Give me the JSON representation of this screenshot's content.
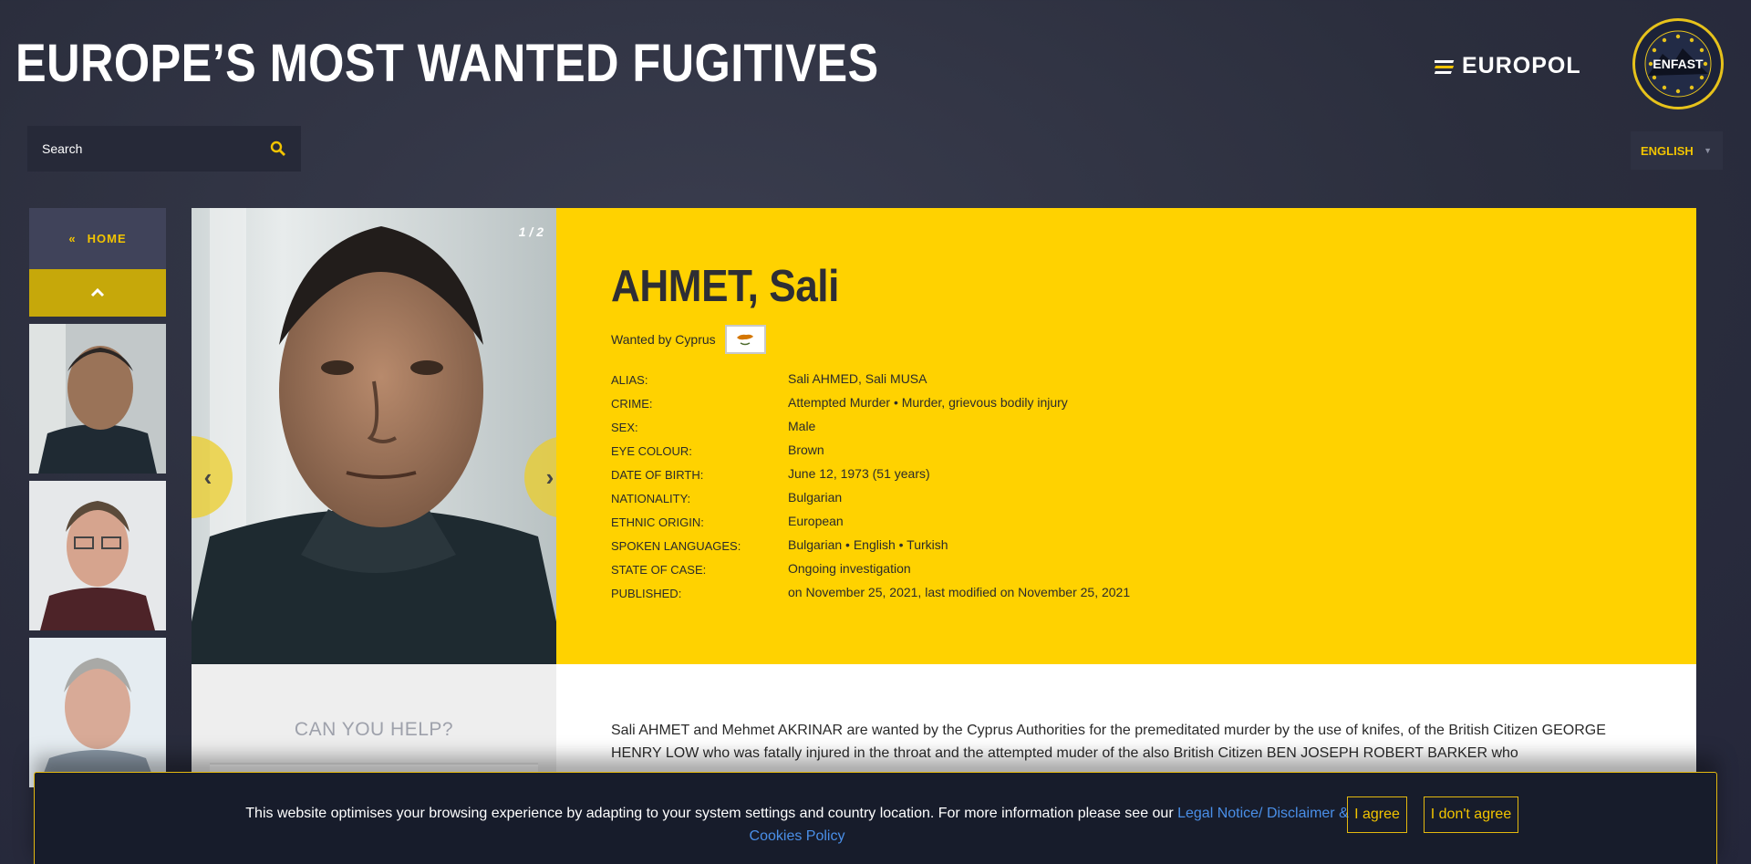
{
  "header": {
    "title": "EUROPE’S MOST WANTED FUGITIVES",
    "europol_logo": "EUROPOL",
    "enfast_logo": "ENFAST"
  },
  "search": {
    "placeholder": "Search"
  },
  "language": {
    "selected": "ENGLISH"
  },
  "sidebar": {
    "home_label": "HOME",
    "home_icon": "double-chevron-left-icon",
    "up_icon": "chevron-up-icon"
  },
  "profile": {
    "photo_counter": "1 / 2",
    "name": "AHMET, Sali",
    "wanted_by": "Wanted by Cyprus",
    "facts": [
      {
        "label": "ALIAS:",
        "value": "Sali AHMED, Sali MUSA"
      },
      {
        "label": "CRIME:",
        "value": "Attempted Murder • Murder, grievous bodily injury"
      },
      {
        "label": "SEX:",
        "value": "Male"
      },
      {
        "label": "EYE COLOUR:",
        "value": "Brown"
      },
      {
        "label": "DATE OF BIRTH:",
        "value": "June 12, 1973 (51 years)"
      },
      {
        "label": "NATIONALITY:",
        "value": "Bulgarian"
      },
      {
        "label": "ETHNIC ORIGIN:",
        "value": "European"
      },
      {
        "label": "SPOKEN LANGUAGES:",
        "value": "Bulgarian • English • Turkish"
      },
      {
        "label": "STATE OF CASE:",
        "value": "Ongoing investigation"
      },
      {
        "label": "PUBLISHED:",
        "value": "on November 25, 2021, last modified on November 25, 2021"
      }
    ],
    "description": "Sali AHMET and  Mehmet AKRINAR are wanted by the Cyprus Authorities for the premeditated murder by the use of knifes, of the British Citizen GEORGE HENRY LOW who was fatally injured in the throat and the attempted muder of the also British Citizen BEN JOSEPH ROBERT BARKER who"
  },
  "help": {
    "title": "CAN YOU HELP?"
  },
  "cookie": {
    "text": "This website optimises your browsing experience by adapting to your system settings and country location. For more information please see our ",
    "link_text": "Legal Notice/ Disclaimer & Cookies Policy",
    "agree_label": "I agree",
    "disagree_label": "I don't agree"
  },
  "colors": {
    "accent": "#ffd200",
    "background": "#2b2e3d",
    "link": "#4a8fe8"
  }
}
